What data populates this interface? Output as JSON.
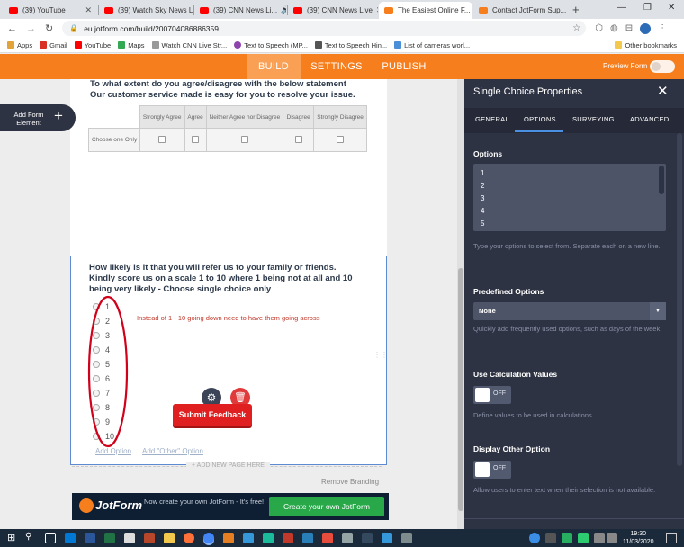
{
  "browser": {
    "tabs": [
      {
        "title": "(39) YouTube",
        "color": "#ff0000"
      },
      {
        "title": "(39) Watch Sky News Li...",
        "color": "#ff0000"
      },
      {
        "title": "(39) CNN News Li...",
        "color": "#ff0000"
      },
      {
        "title": "(39) CNN News Live",
        "color": "#ff0000"
      },
      {
        "title": "The Easiest Online F...",
        "color": "#f77e1d"
      },
      {
        "title": "Contact JotForm Sup...",
        "color": "#f77e1d"
      }
    ],
    "url": "eu.jotform.com/build/200704086886359",
    "bookmarks": [
      "Apps",
      "Gmail",
      "YouTube",
      "Maps",
      "Watch CNN Live Str...",
      "Text to Speech (MP...",
      "Text to Speech Hin...",
      "List of cameras worl..."
    ],
    "other_bookmarks": "Other bookmarks"
  },
  "nav": {
    "tabs": [
      "BUILD",
      "SETTINGS",
      "PUBLISH"
    ],
    "preview_label": "Preview Form"
  },
  "sidebar": {
    "add_element": "Add Form Element"
  },
  "form": {
    "matrix": {
      "question": "To what extent do you agree/disagree with the below statement",
      "statement": "Our customer service made is easy for you to resolve your issue.",
      "columns": [
        "Strongly Agree",
        "Agree",
        "Neither Agree nor Disagree",
        "Disagree",
        "Strongly Disagree"
      ],
      "row_label": "Choose one Only"
    },
    "single_choice": {
      "question": "How likely is it that you will refer us to your family or friends. Kindly score us on a scale 1 to 10 where 1 being not at all and 10 being very likely - Choose single choice only",
      "options": [
        "1",
        "2",
        "3",
        "4",
        "5",
        "6",
        "7",
        "8",
        "9",
        "10"
      ],
      "annotation": "Instead of 1 - 10 going down need to have them going across",
      "add_option": "Add Option",
      "add_other_option": "Add \"Other\" Option"
    },
    "submit_label": "Submit Feedback",
    "add_new_page": "+ ADD NEW PAGE HERE",
    "remove_branding": "Remove Branding",
    "banner": {
      "logo": "JotForm",
      "text": "Now create your own JotForm - It's free!",
      "button": "Create your own JotForm"
    }
  },
  "panel": {
    "title": "Single Choice Properties",
    "tabs": [
      "GENERAL",
      "OPTIONS",
      "SURVEYING",
      "ADVANCED"
    ],
    "options_label": "Options",
    "options_values": [
      "1",
      "2",
      "3",
      "4",
      "5"
    ],
    "options_hint": "Type your options to select from. Separate each on a new line.",
    "predefined_label": "Predefined Options",
    "predefined_value": "None",
    "predefined_hint": "Quickly add frequently used options, such as days of the week.",
    "calc_label": "Use Calculation Values",
    "calc_toggle": "OFF",
    "calc_hint": "Define values to be used in calculations.",
    "other_label": "Display Other Option",
    "other_toggle": "OFF",
    "other_hint": "Allow users to enter text when their selection is not available."
  },
  "taskbar": {
    "time": "19:30",
    "date": "11/03/2020"
  }
}
